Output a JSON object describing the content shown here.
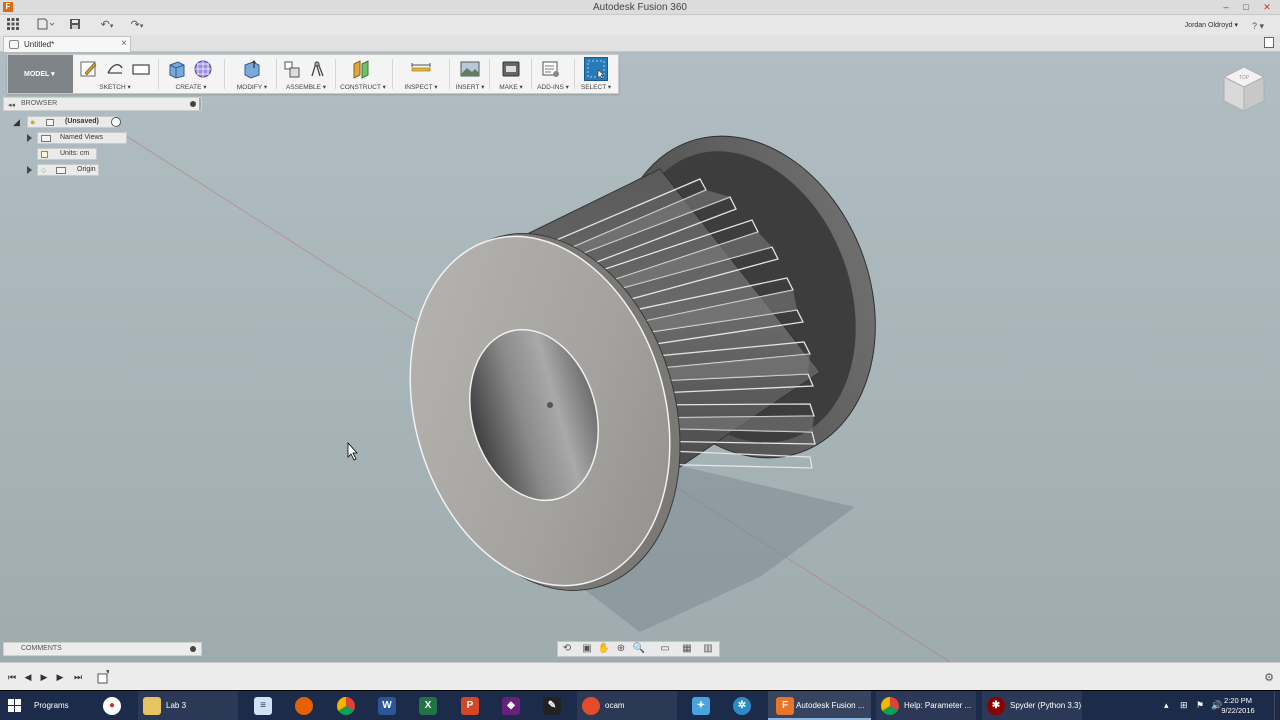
{
  "window": {
    "title": "Autodesk Fusion 360",
    "app_icon": "F",
    "user": "Jordan Oldroyd ▾",
    "help": "? ▾"
  },
  "document_tab": {
    "label": "Untitled*",
    "close": "×"
  },
  "toolbar": {
    "workspace": "MODEL ▾",
    "groups": [
      {
        "label": "SKETCH ▾"
      },
      {
        "label": "CREATE ▾"
      },
      {
        "label": "MODIFY ▾"
      },
      {
        "label": "ASSEMBLE ▾"
      },
      {
        "label": "CONSTRUCT ▾"
      },
      {
        "label": "INSPECT ▾"
      },
      {
        "label": "INSERT ▾"
      },
      {
        "label": "MAKE ▾"
      },
      {
        "label": "ADD-INS ▾"
      },
      {
        "label": "SELECT ▾"
      }
    ]
  },
  "browser": {
    "title": "BROWSER",
    "root": "(Unsaved)",
    "items": [
      "Named Views",
      "Units: cm",
      "Origin"
    ]
  },
  "comments": {
    "title": "COMMENTS"
  },
  "taskbar": {
    "items": [
      {
        "label": "Programs",
        "icon": "windows-icon"
      },
      {
        "label": "Lab 3",
        "icon": "folder-icon"
      },
      {
        "label": "ocam",
        "icon": "ocam-icon"
      },
      {
        "label": "Autodesk Fusion ...",
        "icon": "fusion-icon"
      },
      {
        "label": "Help: Parameter ...",
        "icon": "chrome-icon"
      },
      {
        "label": "Spyder (Python 3.3)",
        "icon": "spyder-icon"
      }
    ],
    "clock_time": "2:20 PM",
    "clock_date": "9/22/2016"
  },
  "colors": {
    "viewport": "#a7b4b8",
    "accent": "#1f6fb5",
    "taskbar": "#1c2b4a"
  }
}
